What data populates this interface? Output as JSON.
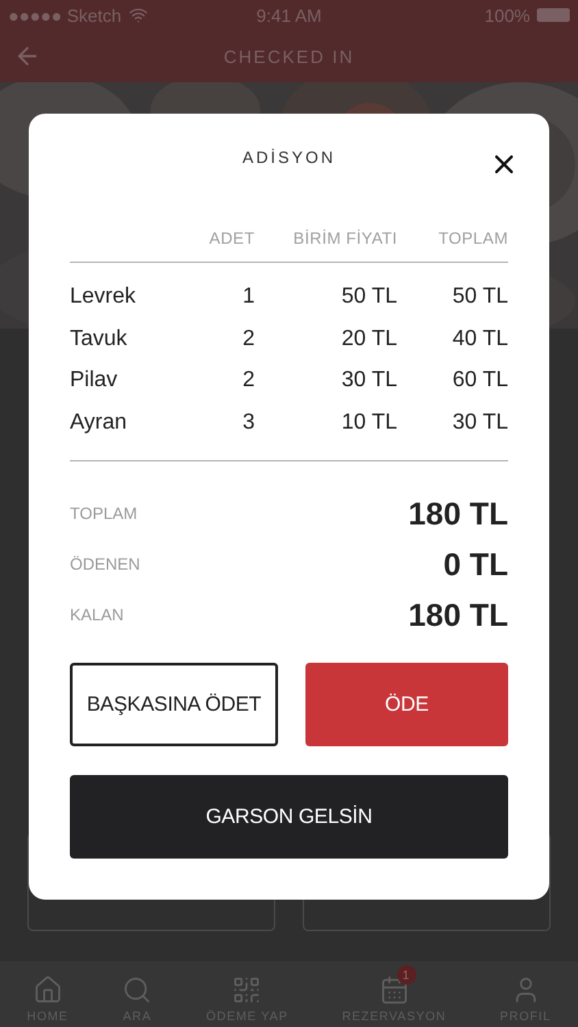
{
  "status_bar": {
    "carrier": "●●●●● Sketch",
    "time": "9:41 AM",
    "battery": "100%"
  },
  "header": {
    "title": "CHECKED IN"
  },
  "modal": {
    "title": "ADİSYON",
    "columns": [
      "ADET",
      "BİRİM FİYATI",
      "TOPLAM"
    ],
    "rows": [
      {
        "item": "Levrek",
        "qty": "1",
        "unit_price": "50 TL",
        "total": "50 TL"
      },
      {
        "item": "Tavuk",
        "qty": "2",
        "unit_price": "20 TL",
        "total": "40 TL"
      },
      {
        "item": "Pilav",
        "qty": "2",
        "unit_price": "30 TL",
        "total": "60 TL"
      },
      {
        "item": "Ayran",
        "qty": "3",
        "unit_price": "10 TL",
        "total": "30 TL"
      }
    ],
    "summary": [
      {
        "label": "TOPLAM",
        "value": "180 TL"
      },
      {
        "label": "ÖDENEN",
        "value": "0 TL"
      },
      {
        "label": "KALAN",
        "value": "180 TL"
      }
    ],
    "buttons": [
      {
        "label": "BAŞKASINA ÖDET",
        "kind": "outline"
      },
      {
        "label": "ÖDE",
        "kind": "primary"
      },
      {
        "label": "GARSON GELSİN",
        "kind": "dark"
      }
    ]
  },
  "tab_bar": [
    {
      "label": "HOME",
      "kind": "home"
    },
    {
      "label": "ARA",
      "kind": "search"
    },
    {
      "label": "ÖDEME YAP",
      "kind": "qr"
    },
    {
      "label": "REZERVASYON",
      "kind": "calendar",
      "badge": "1"
    },
    {
      "label": "PROFIL",
      "kind": "profile"
    }
  ]
}
